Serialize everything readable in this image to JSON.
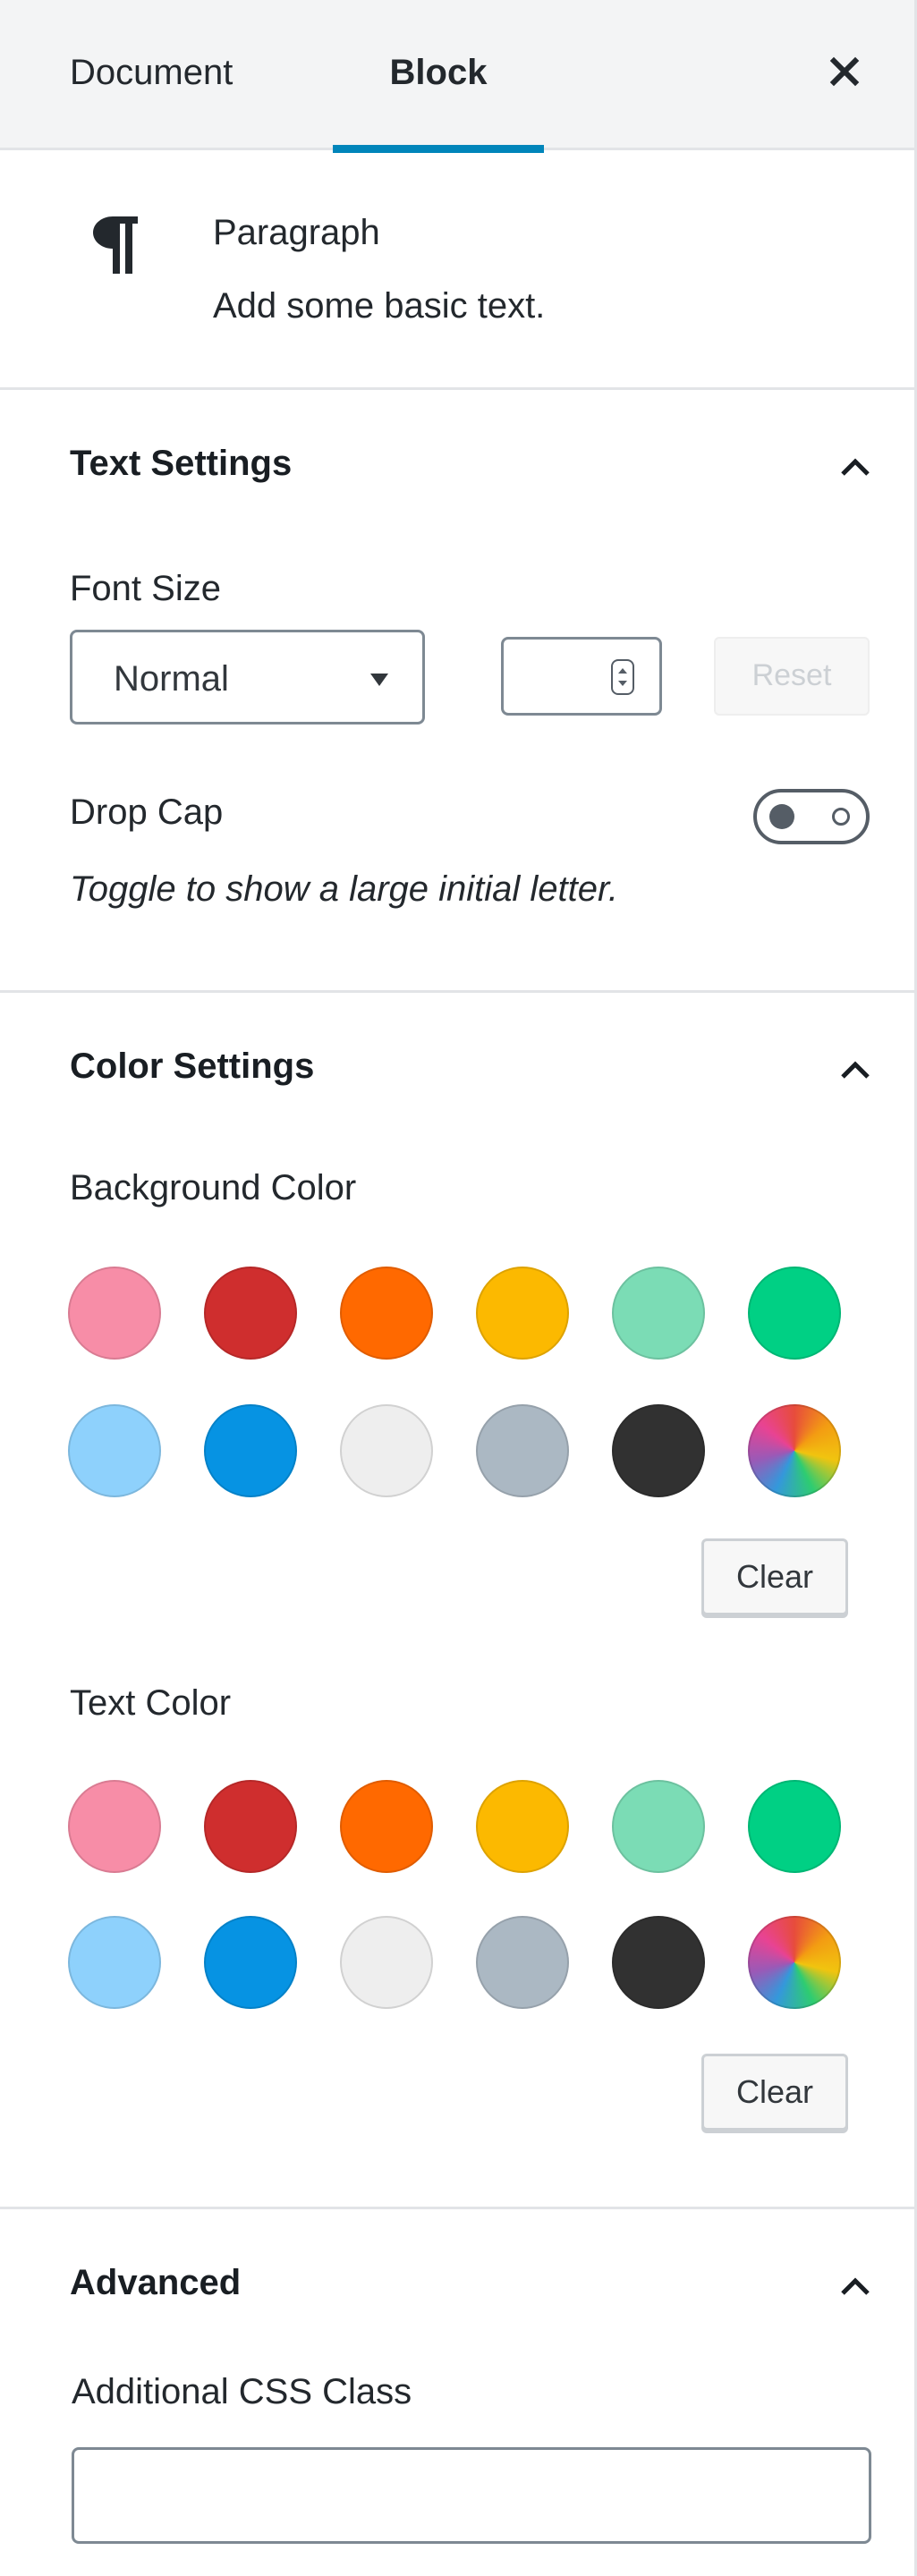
{
  "tabs": {
    "document": "Document",
    "block": "Block"
  },
  "block_card": {
    "title": "Paragraph",
    "description": "Add some basic text."
  },
  "text_settings": {
    "title": "Text Settings",
    "font_size_label": "Font Size",
    "font_size_value": "Normal",
    "custom_size_value": "",
    "reset_label": "Reset",
    "drop_cap_label": "Drop Cap",
    "drop_cap_hint": "Toggle to show a large initial letter."
  },
  "color_settings": {
    "title": "Color Settings",
    "background_label": "Background Color",
    "text_label": "Text Color",
    "clear_label": "Clear",
    "swatch_colors": [
      "#f78da7",
      "#cf2e2e",
      "#ff6900",
      "#fcb900",
      "#7bdcb5",
      "#00d084",
      "#8ed1fc",
      "#0693e3",
      "#eeeeee",
      "#abb8c3",
      "#313131",
      "gradient"
    ]
  },
  "advanced": {
    "title": "Advanced",
    "css_class_label": "Additional CSS Class",
    "css_class_value": ""
  },
  "colors": {
    "accent": "#0085ba",
    "border": "#e2e4e7"
  }
}
